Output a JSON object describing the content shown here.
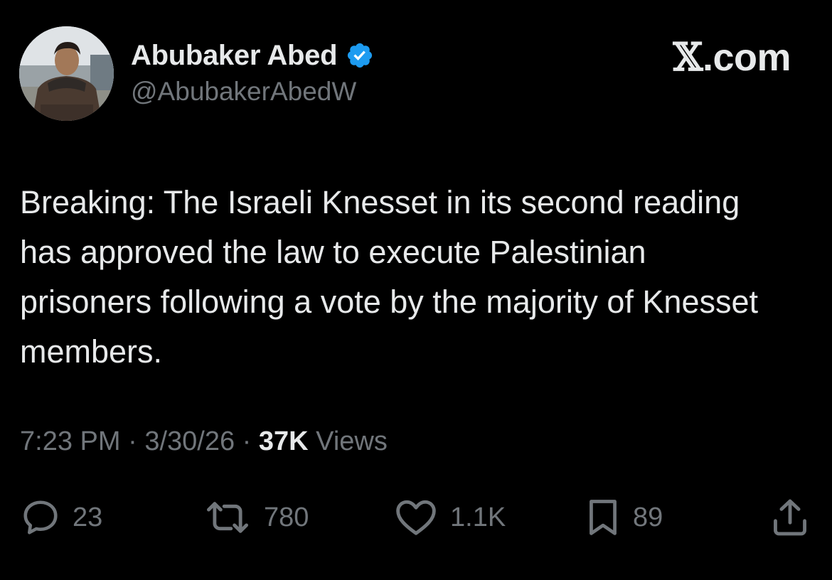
{
  "author": {
    "display_name": "Abubaker Abed",
    "handle": "@AbubakerAbedW",
    "verified": true
  },
  "brand": {
    "x_mark": "𝕏",
    "domain": ".com"
  },
  "tweet": {
    "text": "Breaking: The Israeli Knesset in its second reading has approved the law to execute Palestinian prisoners following a vote by the majority of Knesset members."
  },
  "meta": {
    "time": "7:23 PM",
    "separator": "·",
    "date": "3/30/26",
    "views_count": "37K",
    "views_label": "Views"
  },
  "actions": {
    "replies": {
      "icon": "reply-icon",
      "count": "23"
    },
    "reposts": {
      "icon": "repost-icon",
      "count": "780"
    },
    "likes": {
      "icon": "heart-icon",
      "count": "1.1K"
    },
    "bookmarks": {
      "icon": "bookmark-icon",
      "count": "89"
    },
    "share": {
      "icon": "share-icon"
    }
  },
  "colors": {
    "background": "#000000",
    "primary_text": "#e7e9ea",
    "secondary_text": "#71767b",
    "verified_blue": "#1d9bf0"
  }
}
